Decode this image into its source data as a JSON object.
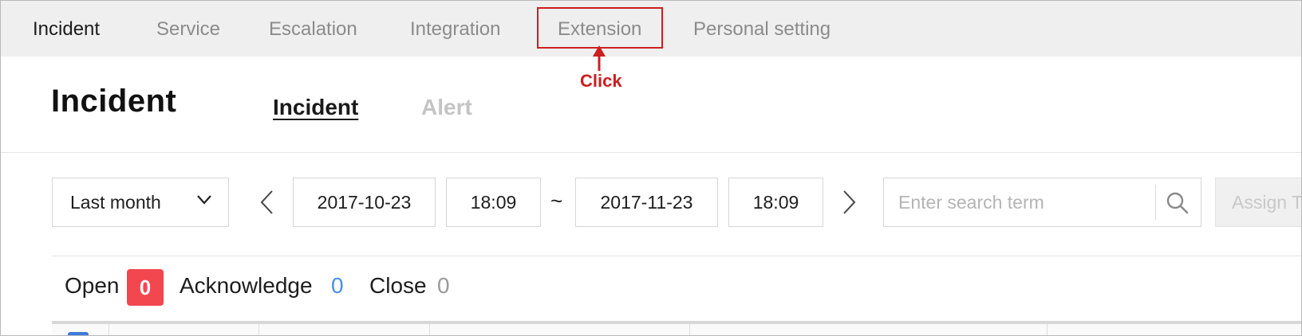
{
  "topnav": {
    "tabs": [
      {
        "label": "Incident",
        "active": true
      },
      {
        "label": "Service",
        "active": false
      },
      {
        "label": "Escalation",
        "active": false
      },
      {
        "label": "Integration",
        "active": false
      },
      {
        "label": "Extension",
        "active": false
      },
      {
        "label": "Personal setting",
        "active": false
      }
    ]
  },
  "annotation": {
    "label": "Click",
    "color": "#cc1f1f"
  },
  "header": {
    "title": "Incident",
    "subtabs": [
      {
        "label": "Incident",
        "active": true
      },
      {
        "label": "Alert",
        "active": false
      }
    ]
  },
  "filter": {
    "period": "Last month",
    "prev_icon": "chevron-left-icon",
    "next_icon": "chevron-right-icon",
    "start_date": "2017-10-23",
    "start_time": "18:09",
    "separator": "~",
    "end_date": "2017-11-23",
    "end_time": "18:09",
    "search_placeholder": "Enter search term",
    "search_value": "",
    "assign_label": "Assign T"
  },
  "status": {
    "open_label": "Open",
    "open_count": "0",
    "acknowledge_label": "Acknowledge",
    "acknowledge_count": "0",
    "close_label": "Close",
    "close_count": "0",
    "colors": {
      "open_badge": "#f2474f",
      "acknowledge": "#4a8ef0",
      "close": "#9a9a9a"
    }
  }
}
